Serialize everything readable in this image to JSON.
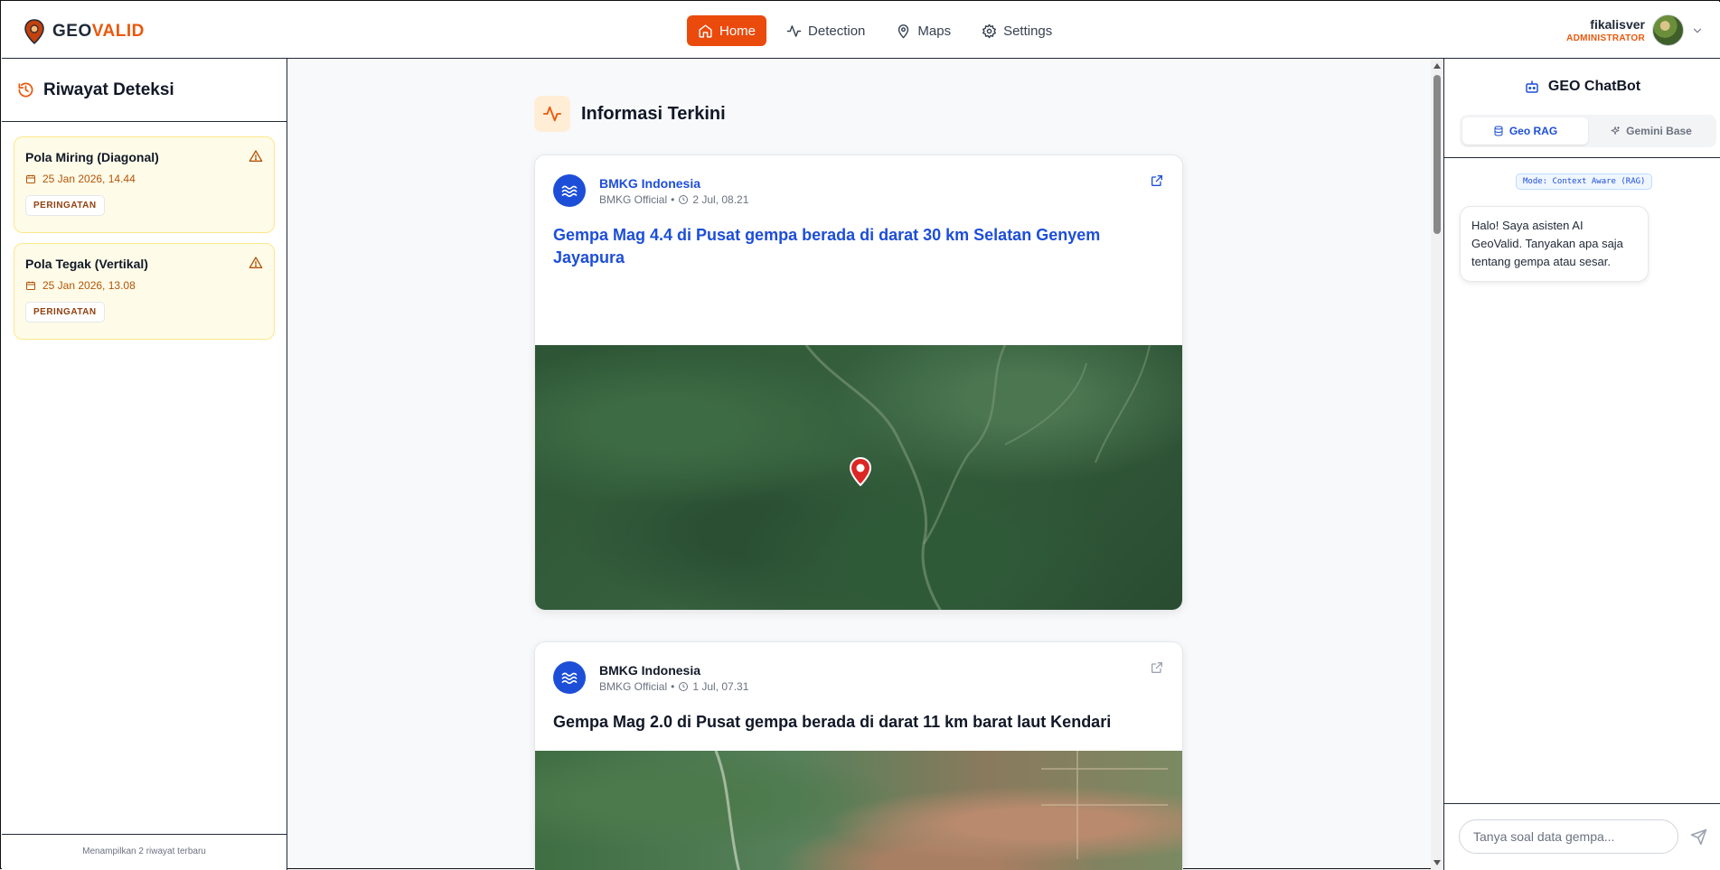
{
  "brand": {
    "part1": "GEO",
    "part2": "VALID"
  },
  "nav": {
    "home": "Home",
    "detection": "Detection",
    "maps": "Maps",
    "settings": "Settings"
  },
  "user": {
    "name": "fikalisver",
    "role": "ADMINISTRATOR"
  },
  "history": {
    "title": "Riwayat Deteksi",
    "items": [
      {
        "title": "Pola Miring (Diagonal)",
        "date": "25 Jan 2026, 14.44",
        "badge": "PERINGATAN"
      },
      {
        "title": "Pola Tegak (Vertikal)",
        "date": "25 Jan 2026, 13.08",
        "badge": "PERINGATAN"
      }
    ],
    "footer": "Menampilkan 2 riwayat terbaru"
  },
  "feed": {
    "title": "Informasi Terkini",
    "posts": [
      {
        "source": "BMKG Indonesia",
        "author": "BMKG Official",
        "time": "2 Jul, 08.21",
        "headline": "Gempa Mag 4.4 di Pusat gempa berada di darat 30 km Selatan Genyem Jayapura"
      },
      {
        "source": "BMKG Indonesia",
        "author": "BMKG Official",
        "time": "1 Jul, 07.31",
        "headline": "Gempa Mag 2.0 di Pusat gempa berada di darat 11 km barat laut Kendari"
      }
    ]
  },
  "chat": {
    "title": "GEO ChatBot",
    "tab_rag": "Geo RAG",
    "tab_gemini": "Gemini Base",
    "mode": "Mode: Context Aware (RAG)",
    "greeting": "Halo! Saya asisten AI GeoValid. Tanyakan apa saja tentang gempa atau sesar.",
    "input_placeholder": "Tanya soal data gempa..."
  },
  "colors": {
    "accent": "#ea580c",
    "link": "#1d4ed8",
    "warning_bg": "#fefce8"
  },
  "icons": [
    "map-pin-icon",
    "home-icon",
    "activity-icon",
    "map-marker-icon",
    "gear-icon",
    "chevron-down-icon",
    "history-icon",
    "warning-icon",
    "calendar-icon",
    "waves-icon",
    "clock-icon",
    "external-link-icon",
    "bot-icon",
    "database-icon",
    "sparkles-icon",
    "send-icon"
  ]
}
